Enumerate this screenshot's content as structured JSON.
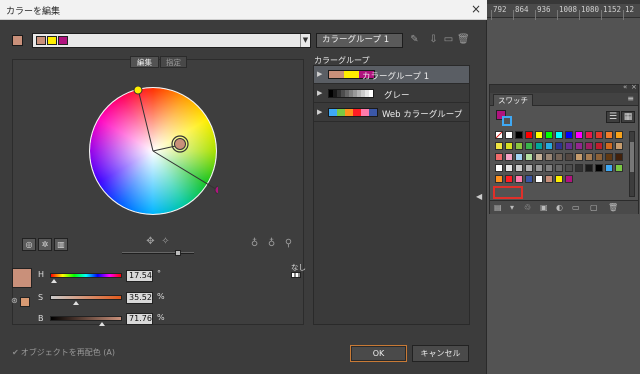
{
  "dialog": {
    "title": "カラーを編集",
    "close_icon": "close-icon",
    "group_name_value": "カラーグループ 1",
    "tabs": {
      "edit": "編集",
      "assign": "指定"
    },
    "hsb": [
      {
        "label": "H",
        "value": "17.54",
        "unit": "°",
        "thumb": 0.05,
        "gradient": "linear-gradient(90deg,#ff0000,#ffff00,#00ff00,#00ffff,#0000ff,#ff00ff,#ff0000)"
      },
      {
        "label": "S",
        "value": "35.52",
        "unit": "%",
        "thumb": 0.3552,
        "gradient": "linear-gradient(90deg,#c9c9c9,#e25a1c)"
      },
      {
        "label": "B",
        "value": "71.76",
        "unit": "%",
        "thumb": 0.7176,
        "gradient": "linear-gradient(90deg,#000000,#c9907a)"
      }
    ],
    "none_label": "なし",
    "recolor_label": "オブジェクトを再配色 (A)",
    "ok_label": "OK",
    "cancel_label": "キャンセル",
    "colors": {
      "base": "#c9907a",
      "yellow": "#ffee00",
      "magenta": "#b0137e",
      "accent": "#c87a36"
    }
  },
  "color_groups": {
    "title": "カラーグループ",
    "items": [
      {
        "name": "カラーグループ 1",
        "selected": true,
        "colors": [
          "#c9907a",
          "#ffee00",
          "#b0137e"
        ]
      },
      {
        "name": "グレー",
        "selected": false,
        "colors": [
          "#000000",
          "#1a1a1a",
          "#333333",
          "#4d4d4d",
          "#666666",
          "#808080",
          "#999999",
          "#b3b3b3",
          "#cccccc",
          "#e6e6e6",
          "#ffffff"
        ]
      },
      {
        "name": "Web カラーグループ",
        "selected": false,
        "colors": [
          "#3fa9f5",
          "#7ac943",
          "#ff931e",
          "#ff1d25",
          "#ff7bac",
          "#3b57a6"
        ]
      }
    ]
  },
  "ruler": {
    "ticks": [
      "792",
      "864",
      "936",
      "1008",
      "1080",
      "1152",
      "12"
    ]
  },
  "swatches_panel": {
    "tab_label": "スワッチ",
    "rows": [
      [
        "none",
        "#ffffff",
        "#000000",
        "#ff0000",
        "#ffff00",
        "#00ff00",
        "#00ffff",
        "#0000ff",
        "#ff00ff",
        "#e6194b",
        "#e0382a",
        "#f07c2a",
        "#f7a21a"
      ],
      [
        "#f0e442",
        "#d7df23",
        "#8dc63f",
        "#39b54a",
        "#00a79d",
        "#27aae1",
        "#2e3192",
        "#662d91",
        "#92278f",
        "#9e1f63",
        "#be1e2d",
        "#d2691e",
        "#c69c6d"
      ],
      [
        "#f26b6b",
        "#f5a3c7",
        "#a3d4f5",
        "#b5e0a3",
        "#c7b299",
        "#998675",
        "#736357",
        "#534741",
        "#c69c6d",
        "#a67c52",
        "#8c6239",
        "#603913",
        "#42210b"
      ],
      [
        "#ffffff",
        "#e6e6e6",
        "#cccccc",
        "#b3b3b3",
        "#999999",
        "#808080",
        "#666666",
        "#4d4d4d",
        "#333333",
        "#1a1a1a",
        "#000000",
        "#3fa9f5",
        "#7ac943"
      ],
      [
        "#ff931e",
        "#ff1d25",
        "#ff7bac",
        "#3b57a6",
        "#ffffff",
        "#c9907a",
        "#ffee00",
        "#b0137e"
      ]
    ]
  }
}
